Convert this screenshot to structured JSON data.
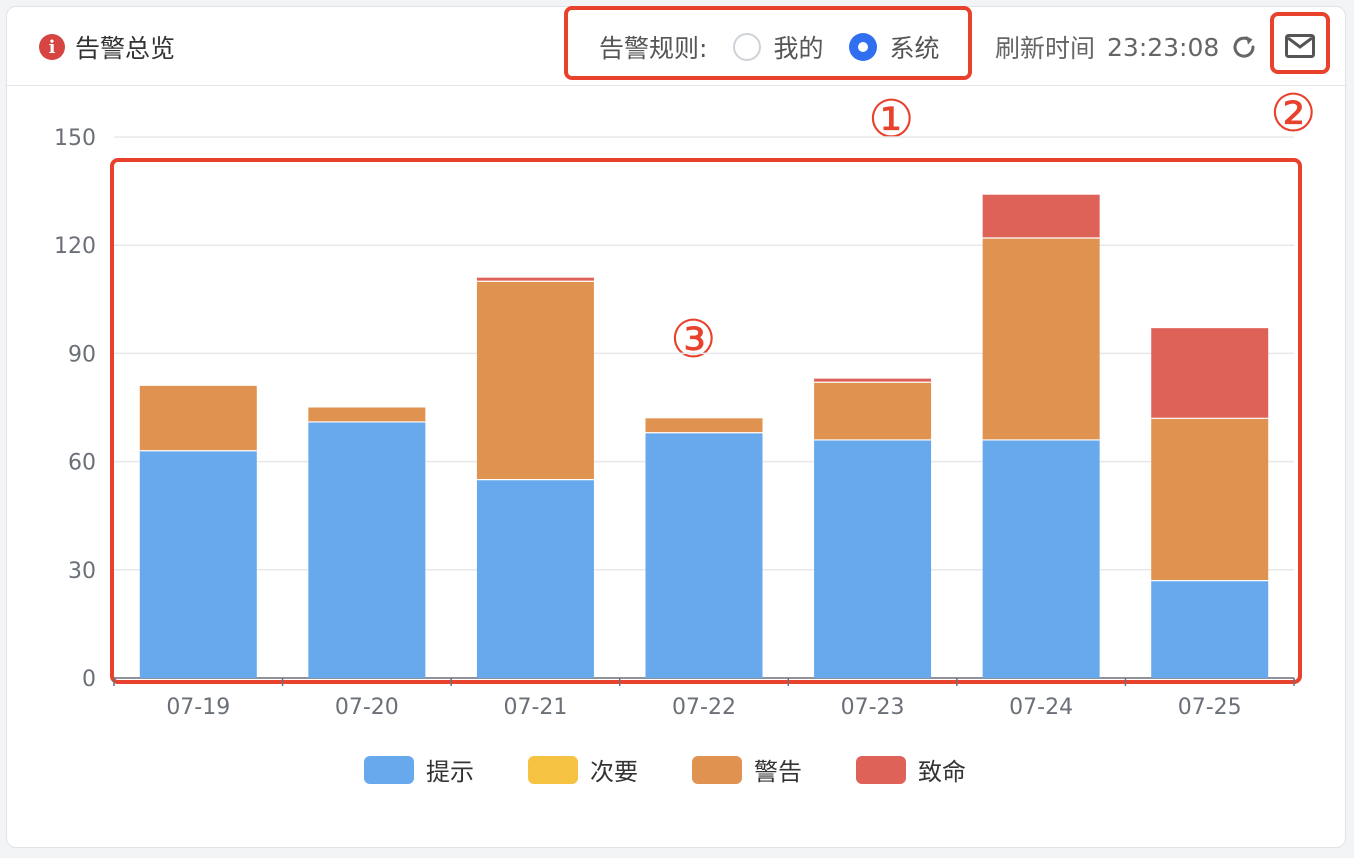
{
  "header": {
    "title": "告警总览",
    "rule_label": "告警规则:",
    "radio_options": [
      {
        "label": "我的",
        "checked": false
      },
      {
        "label": "系统",
        "checked": true
      }
    ],
    "refresh_label": "刷新时间",
    "refresh_time": "23:23:08"
  },
  "annotations": [
    "①",
    "②",
    "③"
  ],
  "colors": {
    "accent": "#2f6ff0",
    "annotation": "#e8412c",
    "info_icon": "#d64541"
  },
  "icons": [
    "info-icon",
    "refresh-icon",
    "mail-icon"
  ],
  "chart_data": {
    "type": "bar",
    "stacked": true,
    "categories": [
      "07-19",
      "07-20",
      "07-21",
      "07-22",
      "07-23",
      "07-24",
      "07-25"
    ],
    "y_ticks": [
      0,
      30,
      60,
      90,
      120,
      150
    ],
    "ylim": [
      0,
      150
    ],
    "grid": true,
    "legend_position": "bottom",
    "series": [
      {
        "name": "提示",
        "color": "#68a8ec",
        "values": [
          63,
          71,
          55,
          68,
          66,
          66,
          27
        ]
      },
      {
        "name": "次要",
        "color": "#f5c242",
        "values": [
          0,
          0,
          0,
          0,
          0,
          0,
          0
        ]
      },
      {
        "name": "警告",
        "color": "#e09251",
        "values": [
          18,
          4,
          55,
          4,
          16,
          56,
          45
        ]
      },
      {
        "name": "致命",
        "color": "#de6258",
        "values": [
          0,
          0,
          1,
          0,
          1,
          12,
          25
        ]
      }
    ]
  }
}
